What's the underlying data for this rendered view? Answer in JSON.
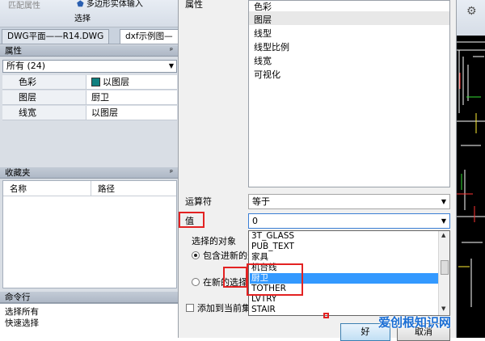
{
  "left_panel": {
    "toolbar": {
      "match_label": "匹配属性",
      "polygon_label": "多边形实体输入",
      "group_label": "选择"
    },
    "tabs": [
      "DWG平面——R14.DWG",
      "dxf示例图—"
    ],
    "properties": {
      "header": "属性",
      "filter": "所有 (24)",
      "rows": [
        {
          "key": "色彩",
          "value": "以图层",
          "color": "#108080"
        },
        {
          "key": "图层",
          "value": "厨卫"
        },
        {
          "key": "线宽",
          "value": "以图层"
        }
      ]
    },
    "favorites": {
      "header": "收藏夹",
      "columns": [
        "名称",
        "路径"
      ]
    },
    "command": {
      "header": "命令行",
      "lines": [
        "选择所有",
        "快速选择"
      ]
    }
  },
  "dialog": {
    "property_label": "属性",
    "property_list": [
      "色彩",
      "图层",
      "线型",
      "线型比例",
      "线宽",
      "可视化"
    ],
    "selected_property_index": 1,
    "operator_label": "运算符",
    "operator_value": "等于",
    "value_label": "值",
    "value_value": "0",
    "value_options": [
      "3T_GLASS",
      "PUB_TEXT",
      "家具",
      "机台线",
      "厨卫",
      "TOTHER",
      "LVTRY",
      "STAIR"
    ],
    "highlighted_option_index": 4,
    "target_group_label": "选择的对象",
    "radio_include": "包含进新的选",
    "radio_exclude": "在新的选择",
    "checkbox_add": "添加到当前集",
    "ok_button": "好",
    "cancel_button": "取消"
  },
  "watermark": "爱创根知识网",
  "colors": {
    "highlight": "#3399ff",
    "annotation_red": "#e32222",
    "layer_swatch": "#108080"
  }
}
